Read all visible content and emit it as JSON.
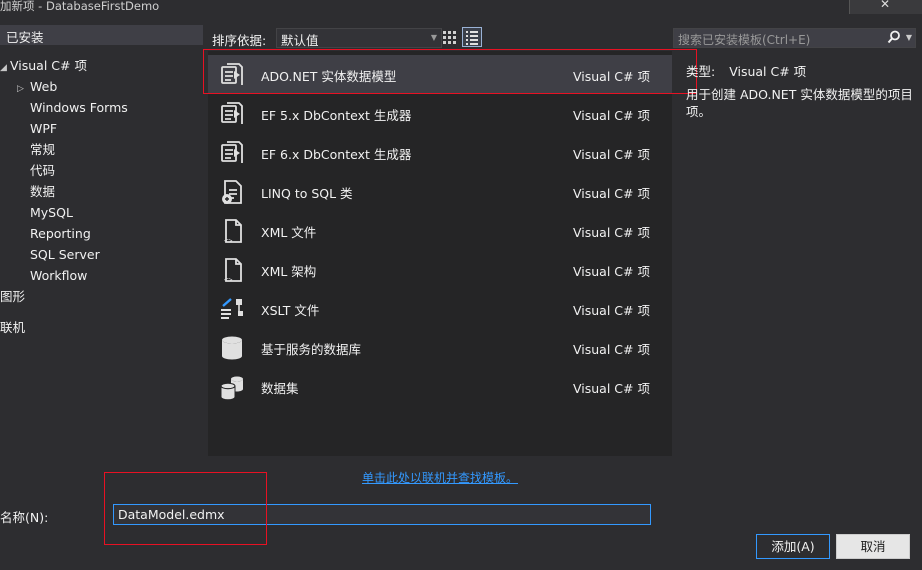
{
  "window": {
    "title": "加新项 - DatabaseFirstDemo"
  },
  "left_panel": {
    "header": "已安装",
    "tree": [
      {
        "label": "Visual C# 项",
        "level": 0,
        "expanded": true
      },
      {
        "label": "Web",
        "level": 1,
        "collapsed": true
      },
      {
        "label": "Windows Forms",
        "level": 1
      },
      {
        "label": "WPF",
        "level": 1
      },
      {
        "label": "常规",
        "level": 1
      },
      {
        "label": "代码",
        "level": 1
      },
      {
        "label": "数据",
        "level": 1
      },
      {
        "label": "MySQL",
        "level": 1
      },
      {
        "label": "Reporting",
        "level": 1
      },
      {
        "label": "SQL Server",
        "level": 1
      },
      {
        "label": "Workflow",
        "level": 1
      },
      {
        "label": "图形",
        "level": 0
      },
      {
        "label": "联机",
        "level": 0
      }
    ]
  },
  "toolbar": {
    "sort_label": "排序依据:",
    "sort_value": "默认值"
  },
  "templates": [
    {
      "name": "ADO.NET 实体数据模型",
      "lang": "Visual C# 项",
      "icon": "entity-model-icon",
      "selected": true
    },
    {
      "name": "EF 5.x DbContext 生成器",
      "lang": "Visual C# 项",
      "icon": "entity-model-icon"
    },
    {
      "name": "EF 6.x DbContext 生成器",
      "lang": "Visual C# 项",
      "icon": "entity-model-icon"
    },
    {
      "name": "LINQ to SQL 类",
      "lang": "Visual C# 项",
      "icon": "linq-to-sql-icon"
    },
    {
      "name": "XML 文件",
      "lang": "Visual C# 项",
      "icon": "xml-file-icon"
    },
    {
      "name": "XML 架构",
      "lang": "Visual C# 项",
      "icon": "xml-schema-icon"
    },
    {
      "name": "XSLT 文件",
      "lang": "Visual C# 项",
      "icon": "xslt-file-icon"
    },
    {
      "name": "基于服务的数据库",
      "lang": "Visual C# 项",
      "icon": "database-icon"
    },
    {
      "name": "数据集",
      "lang": "Visual C# 项",
      "icon": "dataset-icon"
    }
  ],
  "right_panel": {
    "search_placeholder": "搜索已安装模板(Ctrl+E)",
    "type_key": "类型:",
    "type_value": "Visual C# 项",
    "description": "用于创建 ADO.NET 实体数据模型的项目项。"
  },
  "online_link": "单击此处以联机并查找模板。",
  "name_field": {
    "label": "名称(N):",
    "value": "DataModel.edmx"
  },
  "buttons": {
    "add": "添加(A)",
    "cancel": "取消"
  },
  "colors": {
    "background": "#2d2d30",
    "list_background": "#252526",
    "selection": "#3f3f46",
    "accent": "#3399ff",
    "highlight_red": "#e81123"
  }
}
